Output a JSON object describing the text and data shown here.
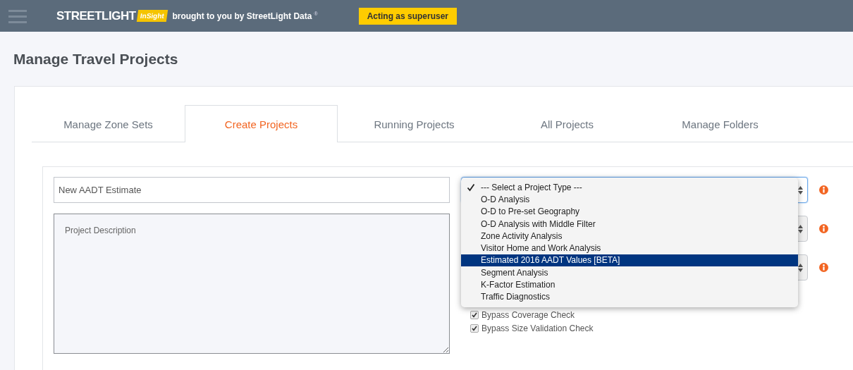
{
  "header": {
    "logo": {
      "brand": "STREETLIGHT",
      "badge": "InSight"
    },
    "tagline": "brought to you by StreetLight Data",
    "registered_mark": "®",
    "superuser_badge": "Acting as superuser"
  },
  "page_title": "Manage Travel Projects",
  "tabs": [
    {
      "label": "Manage Zone Sets",
      "selected": false
    },
    {
      "label": "Create Projects",
      "selected": true
    },
    {
      "label": "Running Projects",
      "selected": false
    },
    {
      "label": "All Projects",
      "selected": false
    },
    {
      "label": "Manage Folders",
      "selected": false
    }
  ],
  "form": {
    "name_field": {
      "value": "New AADT Estimate"
    },
    "description_field": {
      "placeholder": "Project Description"
    },
    "selects": [
      {
        "focused": true
      },
      {
        "focused": false
      },
      {
        "focused": false
      }
    ],
    "dropdown": {
      "options": [
        {
          "label": "--- Select a Project Type ---",
          "checked": true,
          "highlighted": false
        },
        {
          "label": "O-D Analysis",
          "checked": false,
          "highlighted": false
        },
        {
          "label": "O-D to Pre-set Geography",
          "checked": false,
          "highlighted": false
        },
        {
          "label": "O-D Analysis with Middle Filter",
          "checked": false,
          "highlighted": false
        },
        {
          "label": "Zone Activity Analysis",
          "checked": false,
          "highlighted": false
        },
        {
          "label": "Visitor Home and Work Analysis",
          "checked": false,
          "highlighted": false
        },
        {
          "label": "Estimated 2016 AADT Values [BETA]",
          "checked": false,
          "highlighted": true
        },
        {
          "label": "Segment Analysis",
          "checked": false,
          "highlighted": false
        },
        {
          "label": "K-Factor Estimation",
          "checked": false,
          "highlighted": false
        },
        {
          "label": "Traffic Diagnostics",
          "checked": false,
          "highlighted": false
        }
      ]
    },
    "checkboxes": [
      {
        "label": "Bypass Coverage Check",
        "checked": true
      },
      {
        "label": "Bypass Size Validation Check",
        "checked": true
      }
    ]
  }
}
